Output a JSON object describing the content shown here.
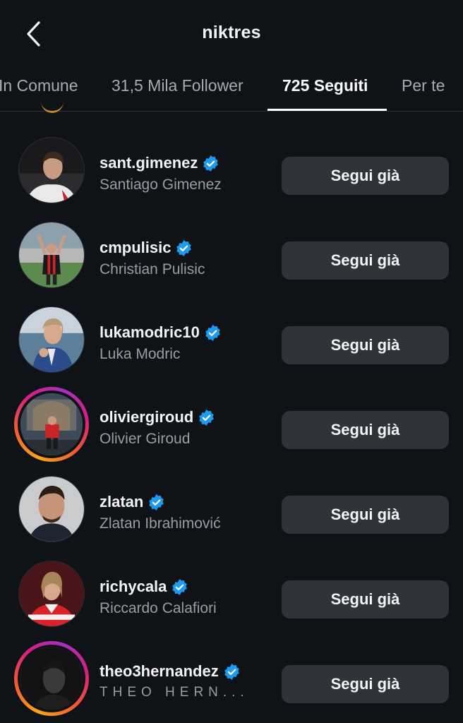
{
  "header": {
    "title": "niktres",
    "back_icon": "chevron-left-icon"
  },
  "tabs": [
    {
      "label": "In Comune",
      "active": false
    },
    {
      "label": "31,5 Mila Follower",
      "active": false
    },
    {
      "label": "725 Seguiti",
      "active": true
    },
    {
      "label": "Per te",
      "active": false
    }
  ],
  "colors": {
    "background": "#0f1217",
    "button": "#30333a",
    "verified": "#1d9bf0",
    "muted_text": "#9a9da3"
  },
  "accounts": [
    {
      "username": "sant.gimenez",
      "full_name": "Santiago Gimenez",
      "verified": true,
      "story_ring": false,
      "button": "Segui già"
    },
    {
      "username": "cmpulisic",
      "full_name": "Christian Pulisic",
      "verified": true,
      "story_ring": false,
      "button": "Segui già"
    },
    {
      "username": "lukamodric10",
      "full_name": "Luka Modric",
      "verified": true,
      "story_ring": false,
      "button": "Segui già"
    },
    {
      "username": "oliviergiroud",
      "full_name": "Olivier Giroud",
      "verified": true,
      "story_ring": true,
      "button": "Segui già"
    },
    {
      "username": "zlatan",
      "full_name": "Zlatan Ibrahimović",
      "verified": true,
      "story_ring": false,
      "button": "Segui già"
    },
    {
      "username": "richycala",
      "full_name": "Riccardo Calafiori",
      "verified": true,
      "story_ring": false,
      "button": "Segui già"
    },
    {
      "username": "theo3hernandez",
      "full_name": "THEO HERN...",
      "verified": true,
      "story_ring": true,
      "button": "Segui già"
    }
  ]
}
